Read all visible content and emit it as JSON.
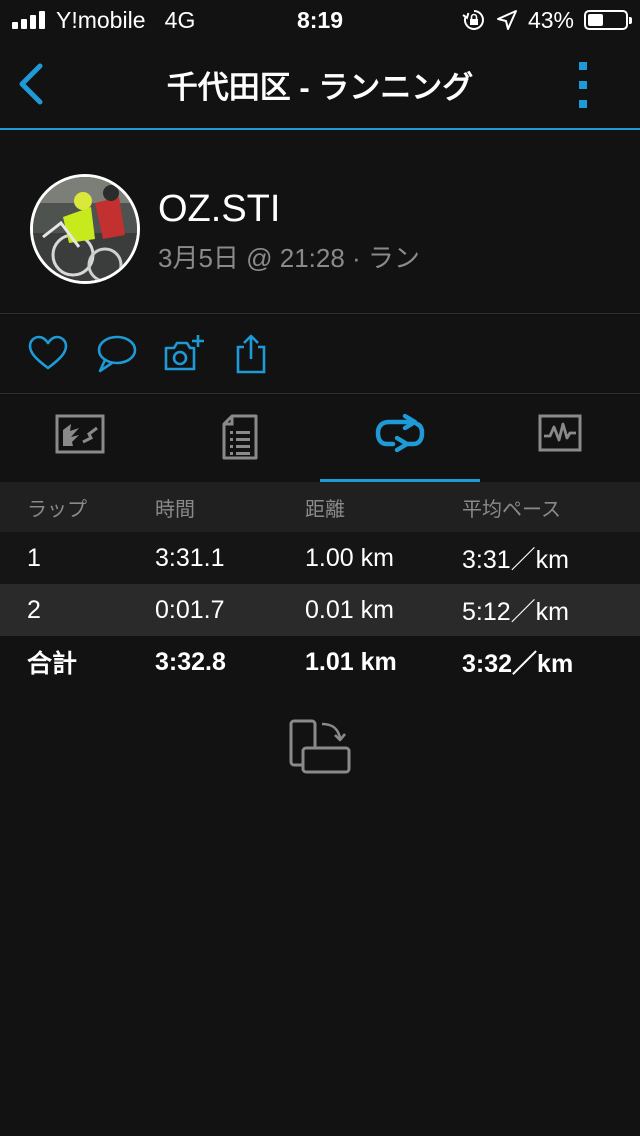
{
  "status_bar": {
    "carrier": "Y!mobile",
    "network": "4G",
    "time": "8:19",
    "battery_percent": "43%",
    "battery_level": 0.43
  },
  "nav": {
    "title": "千代田区 - ランニング"
  },
  "profile": {
    "name": "OZ.STI",
    "meta": "3月5日 @ 21:28 · ラン"
  },
  "icons": {
    "like": "heart-icon",
    "comment": "comment-icon",
    "photo": "camera-add-icon",
    "share": "share-icon",
    "tab_map": "map-tab-icon",
    "tab_stats": "stats-tab-icon",
    "tab_laps": "laps-tab-icon",
    "tab_charts": "charts-tab-icon",
    "rotate": "rotate-device-icon"
  },
  "colors": {
    "accent": "#1e9ad6",
    "background": "#121212",
    "header_row": "#202020",
    "alt_row": "#2a2a2a",
    "muted_text": "#8a8a8a"
  },
  "laps_table": {
    "headers": [
      "ラップ",
      "時間",
      "距離",
      "平均ペース"
    ],
    "rows": [
      [
        "1",
        "3:31.1",
        "1.00 km",
        "3:31／km"
      ],
      [
        "2",
        "0:01.7",
        "0.01 km",
        "5:12／km"
      ]
    ],
    "total": [
      "合計",
      "3:32.8",
      "1.01 km",
      "3:32／km"
    ]
  }
}
